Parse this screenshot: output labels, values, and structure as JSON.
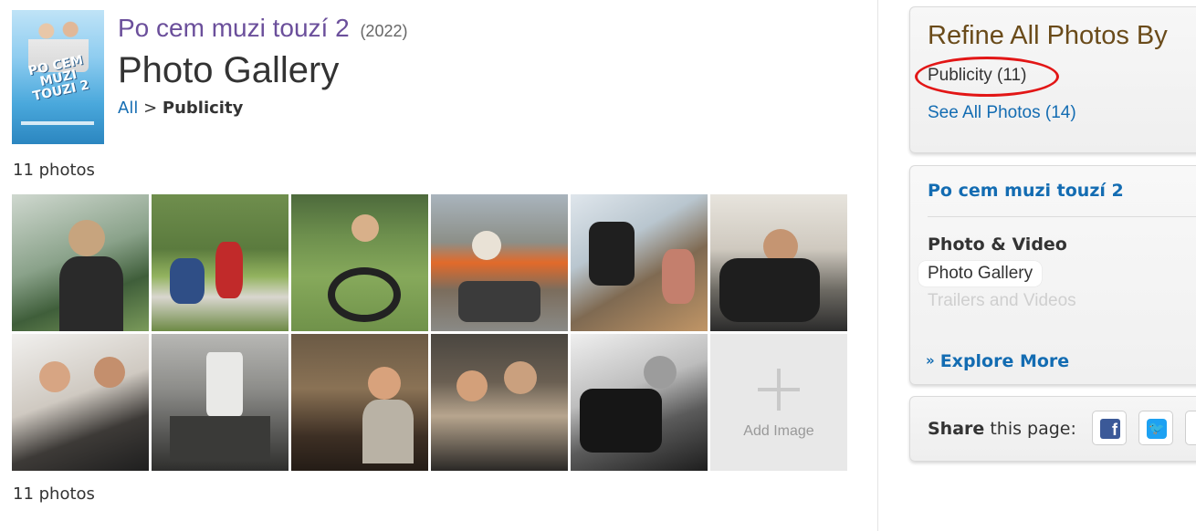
{
  "poster": {
    "title_art": "PO CEM MUZI TOUZI 2"
  },
  "header": {
    "movie_title": "Po cem muzi touzí 2",
    "year": "(2022)",
    "page_title": "Photo Gallery",
    "breadcrumb": {
      "all": "All",
      "separator": ">",
      "current": "Publicity"
    }
  },
  "gallery": {
    "count_label": "11 photos",
    "photos": [
      {
        "icon": "photo-camera-operator"
      },
      {
        "icon": "photo-field-shoot"
      },
      {
        "icon": "photo-dolly-wheelchair"
      },
      {
        "icon": "photo-crew-orange-vests"
      },
      {
        "icon": "photo-set-interior"
      },
      {
        "icon": "photo-camera-closeup"
      },
      {
        "icon": "photo-crew-indoor"
      },
      {
        "icon": "photo-stairwell-bw"
      },
      {
        "icon": "photo-crew-smiling"
      },
      {
        "icon": "photo-crew-monitor"
      },
      {
        "icon": "photo-camera-bw"
      }
    ],
    "add_image_label": "Add Image"
  },
  "sidebar": {
    "refine": {
      "title": "Refine All Photos By",
      "current": "Publicity (11)",
      "see_all": "See All Photos (14)"
    },
    "nav": {
      "title": "Po cem muzi touzí 2",
      "section": "Photo & Video",
      "active_item": "Photo Gallery",
      "faded_item": "Trailers and Videos",
      "explore_more": "Explore More"
    },
    "share": {
      "label_bold": "Share",
      "label_rest": " this page:"
    }
  },
  "colors": {
    "link": "#136cb2",
    "movie_title": "#6b4f9b",
    "refine_title": "#6a4b1a",
    "annotation": "#e21616",
    "facebook": "#3b5998",
    "twitter": "#1da1f2"
  }
}
